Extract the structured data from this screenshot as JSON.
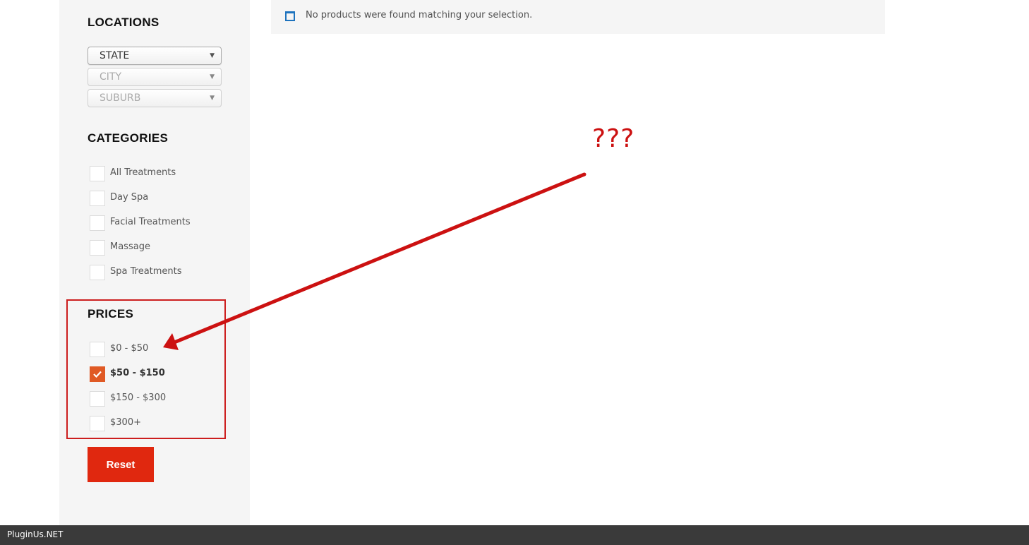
{
  "filters": {
    "locations": {
      "title": "LOCATIONS",
      "selects": [
        {
          "value": "STATE"
        },
        {
          "value": "CITY"
        },
        {
          "value": "SUBURB"
        }
      ]
    },
    "categories": {
      "title": "CATEGORIES",
      "items": [
        {
          "label": "All Treatments",
          "checked": false
        },
        {
          "label": "Day Spa",
          "checked": false
        },
        {
          "label": "Facial Treatments",
          "checked": false
        },
        {
          "label": "Massage",
          "checked": false
        },
        {
          "label": "Spa Treatments",
          "checked": false
        }
      ]
    },
    "prices": {
      "title": "PRICES",
      "items": [
        {
          "label": "$0 - $50",
          "checked": false
        },
        {
          "label": "$50 - $150",
          "checked": true
        },
        {
          "label": "$150 - $300",
          "checked": false
        },
        {
          "label": "$300+",
          "checked": false
        }
      ]
    },
    "reset_label": "Reset"
  },
  "notice": {
    "text": "No products were found matching your selection."
  },
  "annotation": {
    "text": "???",
    "color": "#cc1111"
  },
  "footer": {
    "text": "PluginUs.NET"
  },
  "colors": {
    "accent": "#e05a25",
    "button": "#e0280f",
    "info_icon": "#1e73be"
  }
}
